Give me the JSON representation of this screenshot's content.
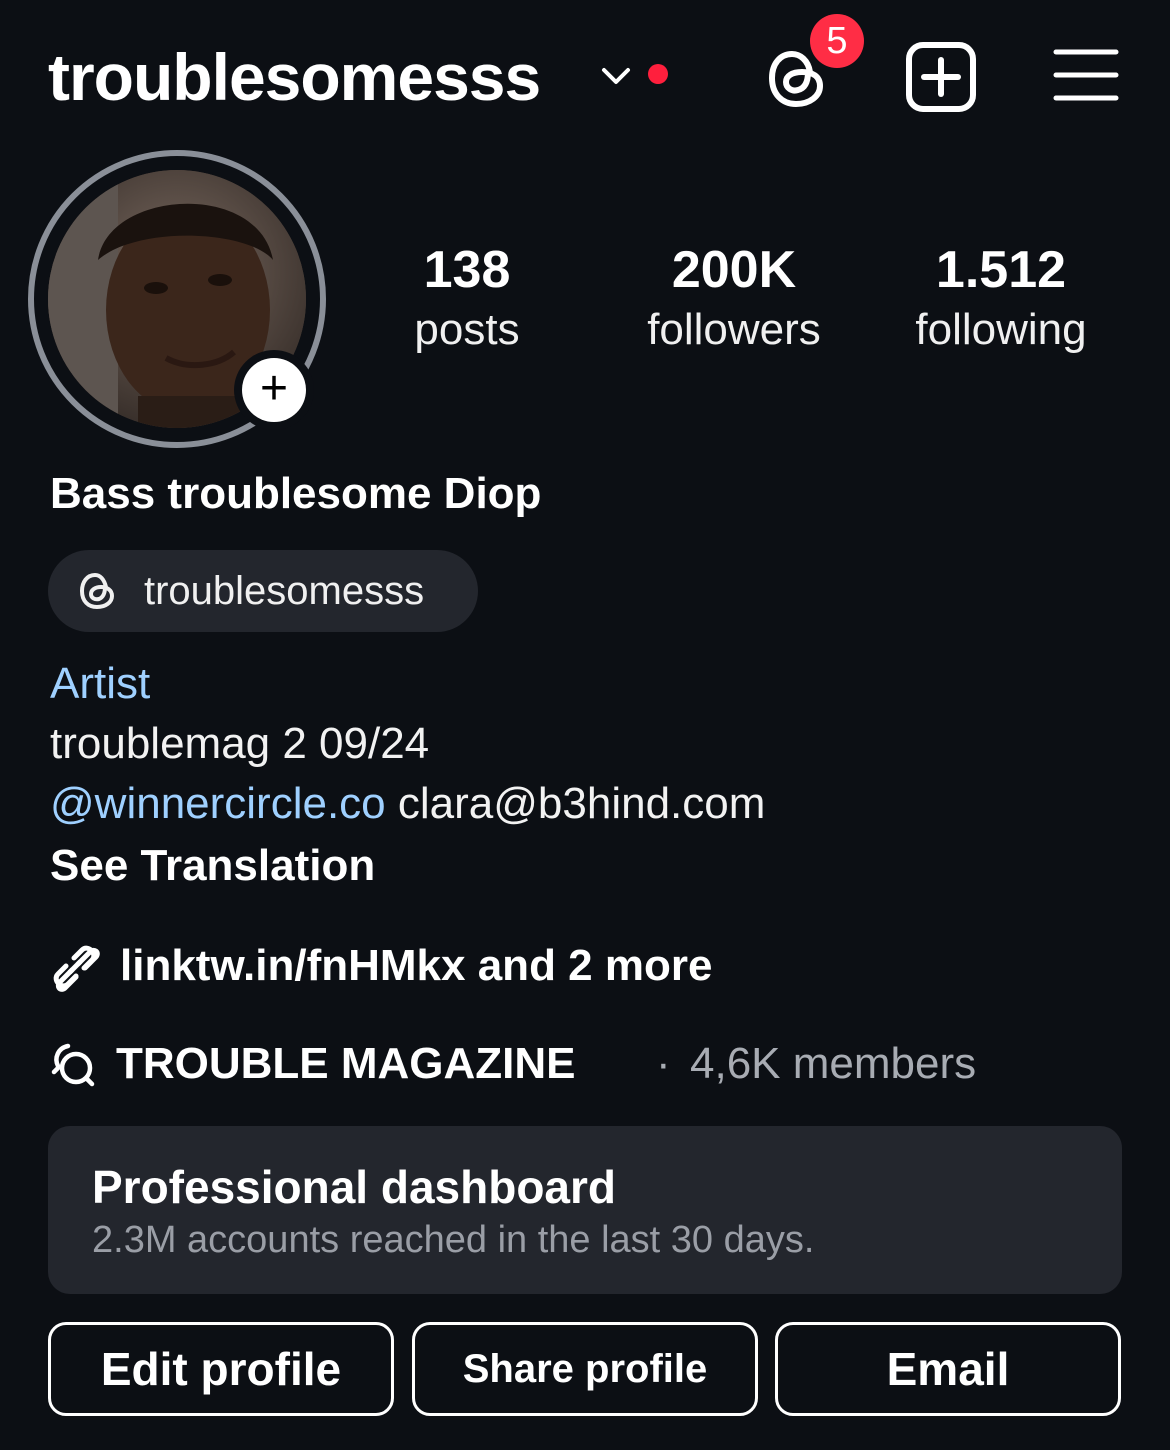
{
  "header": {
    "username": "troublesomesss",
    "threads_badge_count": "5",
    "icons": [
      "chevron-down-icon",
      "threads-icon",
      "new-post-icon",
      "menu-icon"
    ]
  },
  "stats": [
    {
      "value": "138",
      "label": "posts"
    },
    {
      "value": "200K",
      "label": "followers"
    },
    {
      "value": "1.512",
      "label": "following"
    }
  ],
  "profile": {
    "full_name": "Bass troublesome Diop",
    "threads_handle": "troublesomesss",
    "category": "Artist",
    "bio_line1": "troublemag 2 09/24",
    "bio_mention": "@winnercircle.co",
    "bio_email": "clara@b3hind.com",
    "see_translation": "See Translation",
    "link_text": "linktw.in/fnHMkx and 2 more"
  },
  "channel": {
    "name": "TROUBLE MAGAZINE",
    "separator": "·",
    "members": "4,6K members"
  },
  "dashboard": {
    "title": "Professional dashboard",
    "subtitle": "2.3M accounts reached in the last 30 days."
  },
  "buttons": {
    "edit": "Edit profile",
    "share": "Share profile",
    "email": "Email"
  },
  "colors": {
    "background": "#0c0f14",
    "link_blue": "#9fd0ff",
    "badge_red": "#ff2d45",
    "card": "#23262d"
  }
}
